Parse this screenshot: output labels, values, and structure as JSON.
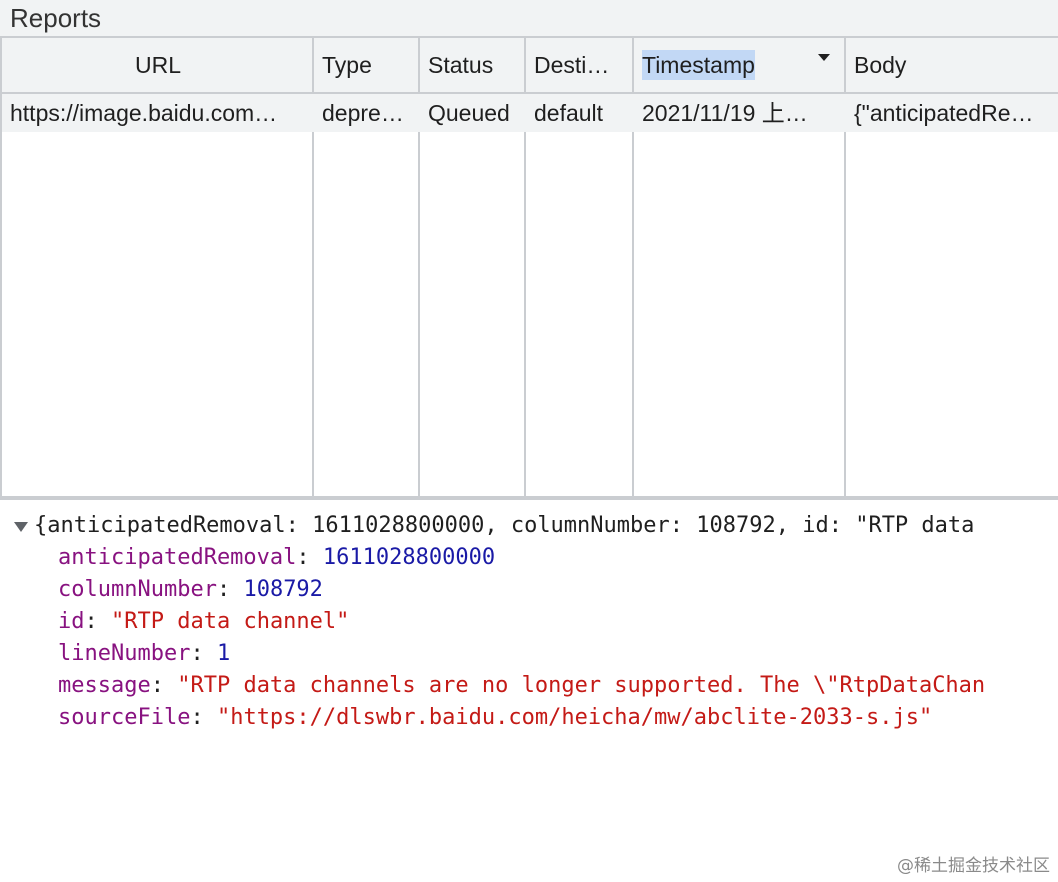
{
  "panel": {
    "title": "Reports"
  },
  "table": {
    "columns": [
      "URL",
      "Type",
      "Status",
      "Desti…",
      "Timestamp",
      "Body"
    ],
    "sorted_column": "Timestamp",
    "rows": [
      [
        "https://image.baidu.com…",
        "depre…",
        "Queued",
        "default",
        "2021/11/19 上…",
        "{\"anticipatedRe…"
      ]
    ]
  },
  "detail": {
    "summary_prefix": "{anticipatedRemoval: 1611028800000, columnNumber: 108792, id: \"RTP data",
    "properties": [
      {
        "key": "anticipatedRemoval",
        "value": "1611028800000",
        "kind": "number"
      },
      {
        "key": "columnNumber",
        "value": "108792",
        "kind": "number"
      },
      {
        "key": "id",
        "value": "\"RTP data channel\"",
        "kind": "string"
      },
      {
        "key": "lineNumber",
        "value": "1",
        "kind": "number"
      },
      {
        "key": "message",
        "value": "\"RTP data channels are no longer supported. The \\\"RtpDataChan",
        "kind": "string"
      },
      {
        "key": "sourceFile",
        "value": "\"https://dlswbr.baidu.com/heicha/mw/abclite-2033-s.js\"",
        "kind": "string"
      }
    ],
    "separator": ": "
  },
  "watermark": "@稀土掘金技术社区",
  "colors": {
    "key": "#881280",
    "number": "#1a1aa6",
    "string": "#c41a16",
    "selection": "#c2d8f5"
  }
}
